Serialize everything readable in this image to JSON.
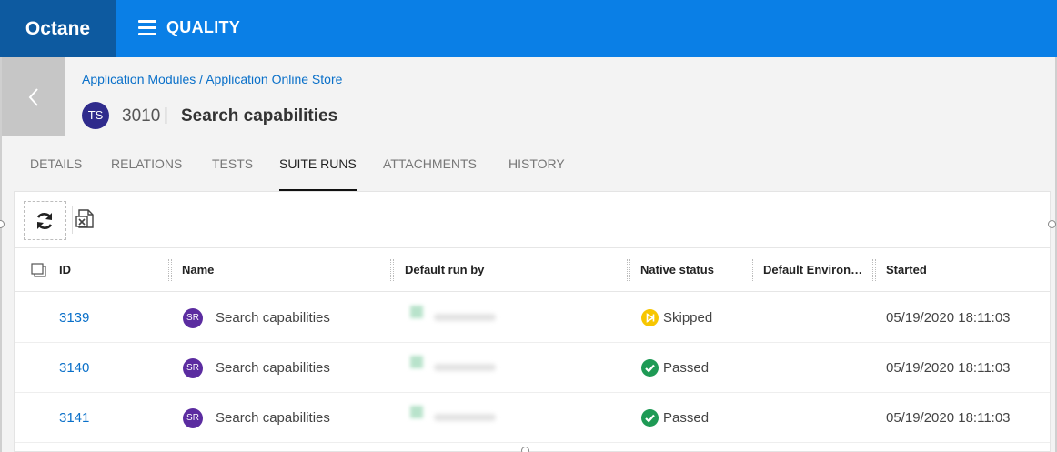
{
  "app": {
    "brand": "Octane",
    "module": "QUALITY"
  },
  "entity": {
    "breadcrumb": "Application Modules / Application Online Store",
    "type_badge": "TS",
    "id": "3010",
    "separator": "|",
    "name": "Search capabilities"
  },
  "tabs": [
    {
      "label": "DETAILS",
      "active": false
    },
    {
      "label": "RELATIONS",
      "active": false
    },
    {
      "label": "TESTS",
      "active": false
    },
    {
      "label": "SUITE RUNS",
      "active": true
    },
    {
      "label": "ATTACHMENTS",
      "active": false
    },
    {
      "label": "HISTORY",
      "active": false
    }
  ],
  "grid": {
    "columns": {
      "id": "ID",
      "name": "Name",
      "default_run_by": "Default run by",
      "native_status": "Native status",
      "default_environment": "Default Environ…",
      "started": "Started"
    },
    "rows": [
      {
        "id": "3139",
        "badge": "SR",
        "name": "Search capabilities",
        "status": "Skipped",
        "status_icon": "skipped-icon",
        "started": "05/19/2020 18:11:03"
      },
      {
        "id": "3140",
        "badge": "SR",
        "name": "Search capabilities",
        "status": "Passed",
        "status_icon": "passed-icon",
        "started": "05/19/2020 18:11:03"
      },
      {
        "id": "3141",
        "badge": "SR",
        "name": "Search capabilities",
        "status": "Passed",
        "status_icon": "passed-icon",
        "started": "05/19/2020 18:11:03"
      }
    ]
  },
  "colors": {
    "topbar": "#0a7fe6",
    "brand_bg": "#0d5aa0",
    "link": "#0a70c9",
    "skipped": "#f7c600",
    "passed": "#1e9a55",
    "ts_badge": "#2f2b8c",
    "sr_badge": "#5b2ca0"
  }
}
